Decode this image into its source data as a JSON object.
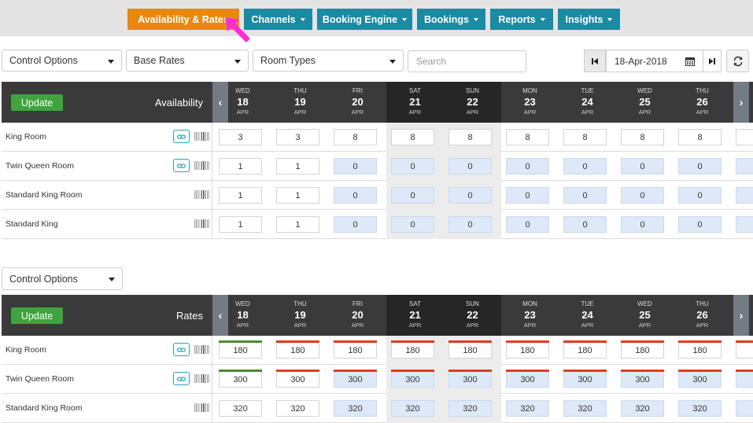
{
  "nav": {
    "tabs": [
      {
        "label": "Availability & Rates",
        "active": true,
        "dropdown": false
      },
      {
        "label": "Channels",
        "active": false,
        "dropdown": true
      },
      {
        "label": "Booking Engine",
        "active": false,
        "dropdown": true
      },
      {
        "label": "Bookings",
        "active": false,
        "dropdown": true
      },
      {
        "label": "Reports",
        "active": false,
        "dropdown": true
      },
      {
        "label": "Insights",
        "active": false,
        "dropdown": true
      }
    ],
    "colors": {
      "active": "#e8880f",
      "inactive": "#1d8aa3",
      "pointer": "#ff2bd6"
    }
  },
  "controls": {
    "control_options": "Control Options",
    "rate_plan": "Base Rates",
    "room_types": "Room Types",
    "search_placeholder": "Search",
    "date": "18-Apr-2018"
  },
  "availability": {
    "title": "Availability",
    "update_label": "Update",
    "days": [
      {
        "dow": "WED",
        "day": "18",
        "mon": "APR",
        "weekend": false
      },
      {
        "dow": "THU",
        "day": "19",
        "mon": "APR",
        "weekend": false
      },
      {
        "dow": "FRI",
        "day": "20",
        "mon": "APR",
        "weekend": false
      },
      {
        "dow": "SAT",
        "day": "21",
        "mon": "APR",
        "weekend": true
      },
      {
        "dow": "SUN",
        "day": "22",
        "mon": "APR",
        "weekend": true
      },
      {
        "dow": "MON",
        "day": "23",
        "mon": "APR",
        "weekend": false
      },
      {
        "dow": "TUE",
        "day": "24",
        "mon": "APR",
        "weekend": false
      },
      {
        "dow": "WED",
        "day": "25",
        "mon": "APR",
        "weekend": false
      },
      {
        "dow": "THU",
        "day": "26",
        "mon": "APR",
        "weekend": false
      }
    ],
    "rows": [
      {
        "name": "King Room",
        "linked": true,
        "values": [
          "3",
          "3",
          "8",
          "8",
          "8",
          "8",
          "8",
          "8",
          "8"
        ],
        "blue": [
          false,
          false,
          false,
          false,
          false,
          false,
          false,
          false,
          false
        ]
      },
      {
        "name": "Twin Queen Room",
        "linked": true,
        "values": [
          "1",
          "1",
          "0",
          "0",
          "0",
          "0",
          "0",
          "0",
          "0"
        ],
        "blue": [
          false,
          false,
          true,
          true,
          true,
          true,
          true,
          true,
          true
        ]
      },
      {
        "name": "Standard King Room",
        "linked": false,
        "values": [
          "1",
          "1",
          "0",
          "0",
          "0",
          "0",
          "0",
          "0",
          "0"
        ],
        "blue": [
          false,
          false,
          true,
          true,
          true,
          true,
          true,
          true,
          true
        ]
      },
      {
        "name": "Standard King",
        "linked": false,
        "values": [
          "1",
          "1",
          "0",
          "0",
          "0",
          "0",
          "0",
          "0",
          "0"
        ],
        "blue": [
          false,
          false,
          true,
          true,
          true,
          true,
          true,
          true,
          true
        ]
      }
    ]
  },
  "rates": {
    "control_options": "Control Options",
    "title": "Rates",
    "update_label": "Update",
    "days": [
      {
        "dow": "WED",
        "day": "18",
        "mon": "APR",
        "weekend": false
      },
      {
        "dow": "THU",
        "day": "19",
        "mon": "APR",
        "weekend": false
      },
      {
        "dow": "FRI",
        "day": "20",
        "mon": "APR",
        "weekend": false
      },
      {
        "dow": "SAT",
        "day": "21",
        "mon": "APR",
        "weekend": true
      },
      {
        "dow": "SUN",
        "day": "22",
        "mon": "APR",
        "weekend": true
      },
      {
        "dow": "MON",
        "day": "23",
        "mon": "APR",
        "weekend": false
      },
      {
        "dow": "TUE",
        "day": "24",
        "mon": "APR",
        "weekend": false
      },
      {
        "dow": "WED",
        "day": "25",
        "mon": "APR",
        "weekend": false
      },
      {
        "dow": "THU",
        "day": "26",
        "mon": "APR",
        "weekend": false
      }
    ],
    "rows": [
      {
        "name": "King Room",
        "linked": true,
        "values": [
          "180",
          "180",
          "180",
          "180",
          "180",
          "180",
          "180",
          "180",
          "180"
        ],
        "blue": [
          false,
          false,
          false,
          false,
          false,
          false,
          false,
          false,
          false
        ],
        "bars": [
          "green",
          "red",
          "red",
          "red",
          "red",
          "red",
          "red",
          "red",
          "red"
        ]
      },
      {
        "name": "Twin Queen Room",
        "linked": true,
        "values": [
          "300",
          "300",
          "300",
          "300",
          "300",
          "300",
          "300",
          "300",
          "300"
        ],
        "blue": [
          false,
          false,
          true,
          true,
          true,
          true,
          true,
          true,
          true
        ],
        "bars": [
          "green",
          "red",
          "red",
          "red",
          "red",
          "red",
          "red",
          "red",
          "red"
        ]
      },
      {
        "name": "Standard King Room",
        "linked": false,
        "values": [
          "320",
          "320",
          "320",
          "320",
          "320",
          "320",
          "320",
          "320",
          "320"
        ],
        "blue": [
          false,
          false,
          true,
          true,
          true,
          true,
          true,
          true,
          true
        ],
        "bars": [
          "none",
          "none",
          "none",
          "none",
          "none",
          "none",
          "none",
          "none",
          "none"
        ]
      }
    ]
  }
}
